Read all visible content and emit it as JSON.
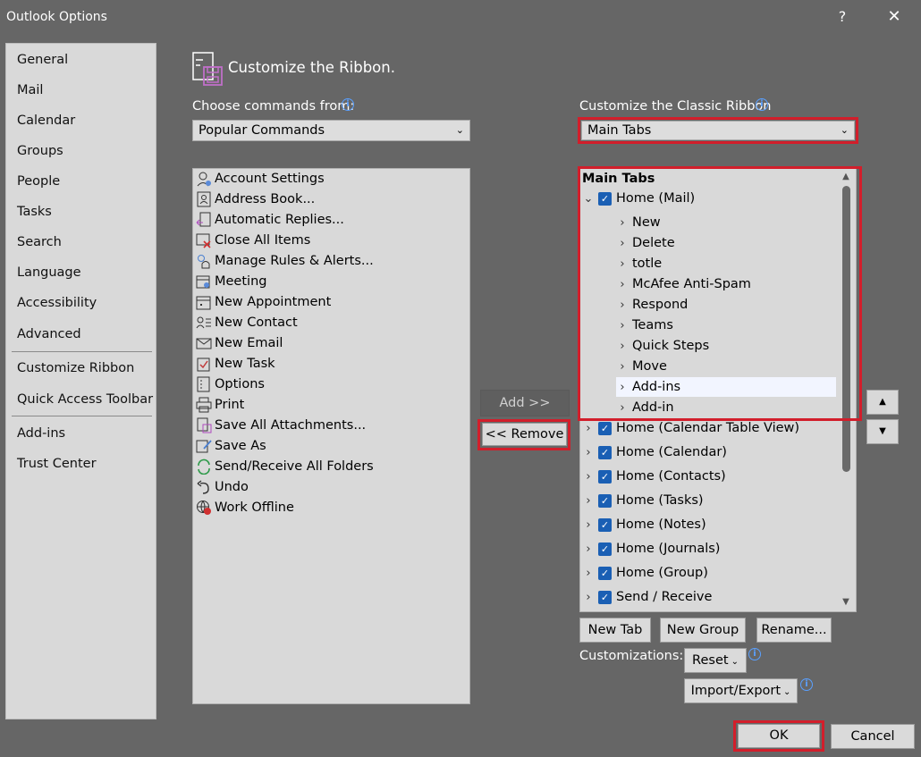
{
  "window": {
    "title": "Outlook Options",
    "help_label": "?",
    "close_label": "✕"
  },
  "nav": {
    "items": [
      {
        "label": "General"
      },
      {
        "label": "Mail"
      },
      {
        "label": "Calendar"
      },
      {
        "label": "Groups"
      },
      {
        "label": "People"
      },
      {
        "label": "Tasks"
      },
      {
        "label": "Search"
      },
      {
        "label": "Language"
      },
      {
        "label": "Accessibility"
      },
      {
        "label": "Advanced"
      },
      {
        "label": "Customize Ribbon"
      },
      {
        "label": "Quick Access Toolbar"
      },
      {
        "label": "Add-ins"
      },
      {
        "label": "Trust Center"
      }
    ]
  },
  "header": {
    "title": "Customize the Ribbon."
  },
  "left_panel": {
    "choose_label": "Choose commands from:",
    "choose_value": "Popular Commands",
    "commands": [
      {
        "label": "Account Settings",
        "icon": "account-settings-icon"
      },
      {
        "label": "Address Book...",
        "icon": "address-book-icon"
      },
      {
        "label": "Automatic Replies...",
        "icon": "automatic-replies-icon"
      },
      {
        "label": "Close All Items",
        "icon": "close-all-items-icon"
      },
      {
        "label": "Manage Rules & Alerts...",
        "icon": "manage-rules-icon"
      },
      {
        "label": "Meeting",
        "icon": "meeting-icon"
      },
      {
        "label": "New Appointment",
        "icon": "new-appointment-icon"
      },
      {
        "label": "New Contact",
        "icon": "new-contact-icon"
      },
      {
        "label": "New Email",
        "icon": "new-email-icon"
      },
      {
        "label": "New Task",
        "icon": "new-task-icon"
      },
      {
        "label": "Options",
        "icon": "options-icon"
      },
      {
        "label": "Print",
        "icon": "print-icon"
      },
      {
        "label": "Save All Attachments...",
        "icon": "save-attachments-icon"
      },
      {
        "label": "Save As",
        "icon": "save-as-icon"
      },
      {
        "label": "Send/Receive All Folders",
        "icon": "send-receive-icon"
      },
      {
        "label": "Undo",
        "icon": "undo-icon"
      },
      {
        "label": "Work Offline",
        "icon": "work-offline-icon"
      }
    ]
  },
  "middle": {
    "add_label": "Add >>",
    "remove_label": "<< Remove"
  },
  "right_panel": {
    "customize_label": "Customize the Classic Ribbon",
    "customize_value": "Main Tabs",
    "tree_header": "Main Tabs",
    "home_mail": "Home (Mail)",
    "home_mail_groups": [
      "New",
      "Delete",
      "totle",
      "McAfee Anti-Spam",
      "Respond",
      "Teams",
      "Quick Steps",
      "Move",
      "Add-ins",
      "Add-in"
    ],
    "other_tabs": [
      "Home (Calendar Table View)",
      "Home (Calendar)",
      "Home (Contacts)",
      "Home (Tasks)",
      "Home (Notes)",
      "Home (Journals)",
      "Home (Group)",
      "Send / Receive"
    ],
    "new_tab_label": "New Tab",
    "new_group_label": "New Group",
    "rename_label": "Rename...",
    "customizations_label": "Customizations:",
    "reset_label": "Reset",
    "import_export_label": "Import/Export"
  },
  "footer": {
    "ok_label": "OK",
    "cancel_label": "Cancel"
  },
  "colors": {
    "background": "#666666",
    "panel": "#d9d9d9",
    "highlight_red": "#d21e2b",
    "checkbox_blue": "#1a5fb4"
  }
}
